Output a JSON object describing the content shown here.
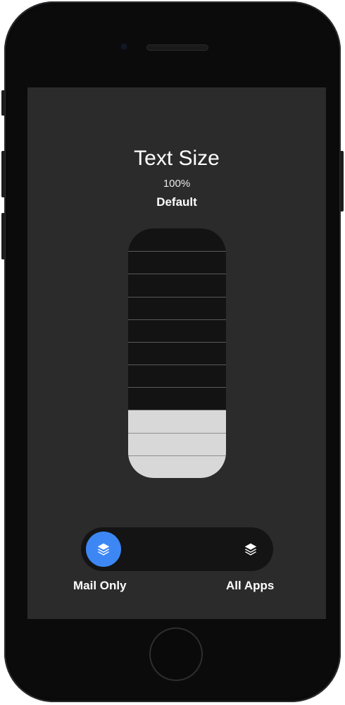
{
  "screen": {
    "title": "Text Size",
    "percent": "100%",
    "size_label": "Default"
  },
  "slider": {
    "steps": 11,
    "level": 3
  },
  "toggle": {
    "left_label": "Mail Only",
    "right_label": "All Apps",
    "selected": "Mail Only",
    "accent_color": "#3d87f5"
  },
  "icons": {
    "mode_icon": "layers-icon"
  }
}
